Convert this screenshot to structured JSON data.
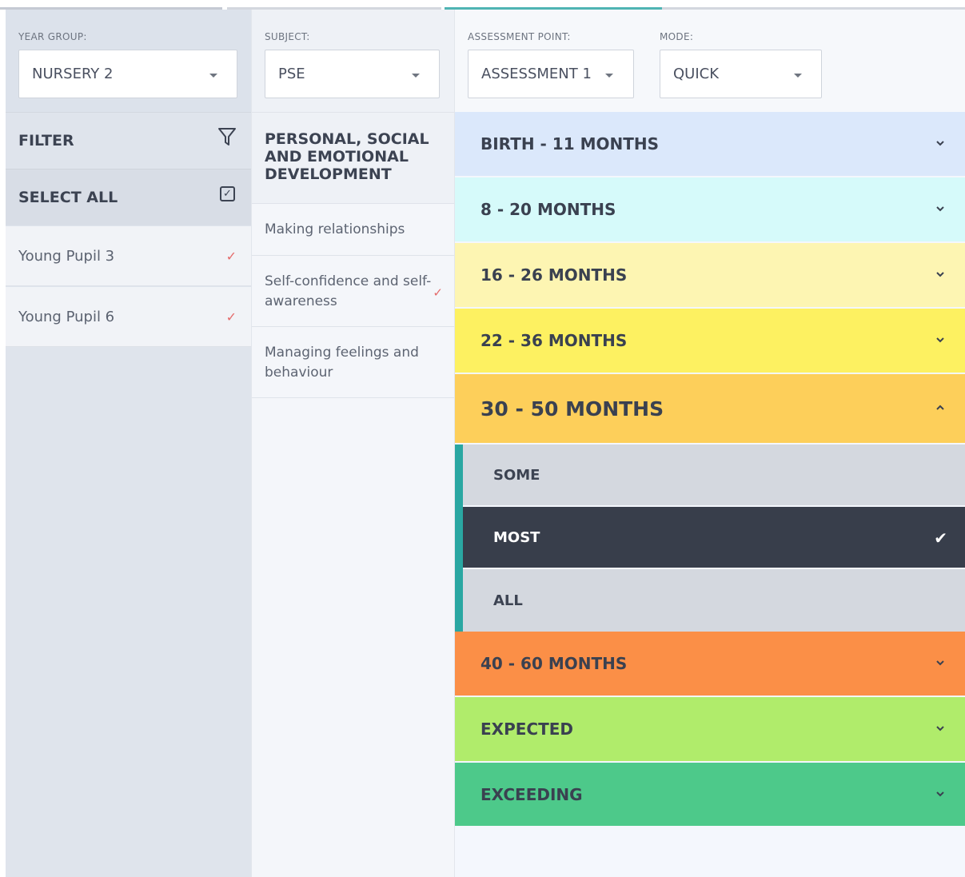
{
  "selectors": {
    "year_group": {
      "label": "YEAR GROUP:",
      "value": "NURSERY 2"
    },
    "subject": {
      "label": "SUBJECT:",
      "value": "PSE"
    },
    "assessment_point": {
      "label": "ASSESSMENT POINT:",
      "value": "ASSESSMENT 1"
    },
    "mode": {
      "label": "MODE:",
      "value": "QUICK"
    }
  },
  "left_panel": {
    "filter_label": "FILTER",
    "select_all_label": "SELECT ALL",
    "pupils": [
      "Young Pupil 3",
      "Young Pupil 6"
    ],
    "check_mark": "✓"
  },
  "middle_panel": {
    "heading": "PERSONAL, SOCIAL AND EMOTIONAL DEVELOPMENT",
    "strands": [
      {
        "line1": "Making relationships",
        "line2": ""
      },
      {
        "line1": "Self-confidence and self-",
        "line2": "awareness"
      },
      {
        "line1": "Managing feelings and",
        "line2": "behaviour"
      }
    ]
  },
  "bands": [
    {
      "label": "BIRTH - 11 MONTHS",
      "color": "#dbe8fb",
      "expanded": false
    },
    {
      "label": "8 - 20 MONTHS",
      "color": "#d6fafa",
      "expanded": false
    },
    {
      "label": "16 - 26 MONTHS",
      "color": "#fdf5b2",
      "expanded": false
    },
    {
      "label": "22 - 36 MONTHS",
      "color": "#fdf161",
      "expanded": false
    },
    {
      "label": "30 - 50 MONTHS",
      "color": "#fdcf5a",
      "expanded": true
    },
    {
      "label": "40 - 60 MONTHS",
      "color": "#fb8f47",
      "expanded": false
    },
    {
      "label": "EXPECTED",
      "color": "#b0ec6b",
      "expanded": false
    },
    {
      "label": "EXCEEDING",
      "color": "#4dc98a",
      "expanded": false
    }
  ],
  "sub_options": [
    {
      "label": "SOME",
      "selected": false
    },
    {
      "label": "MOST",
      "selected": true
    },
    {
      "label": "ALL",
      "selected": false
    }
  ],
  "selected_tick": "✔",
  "accent_color": "#2aa7a2"
}
